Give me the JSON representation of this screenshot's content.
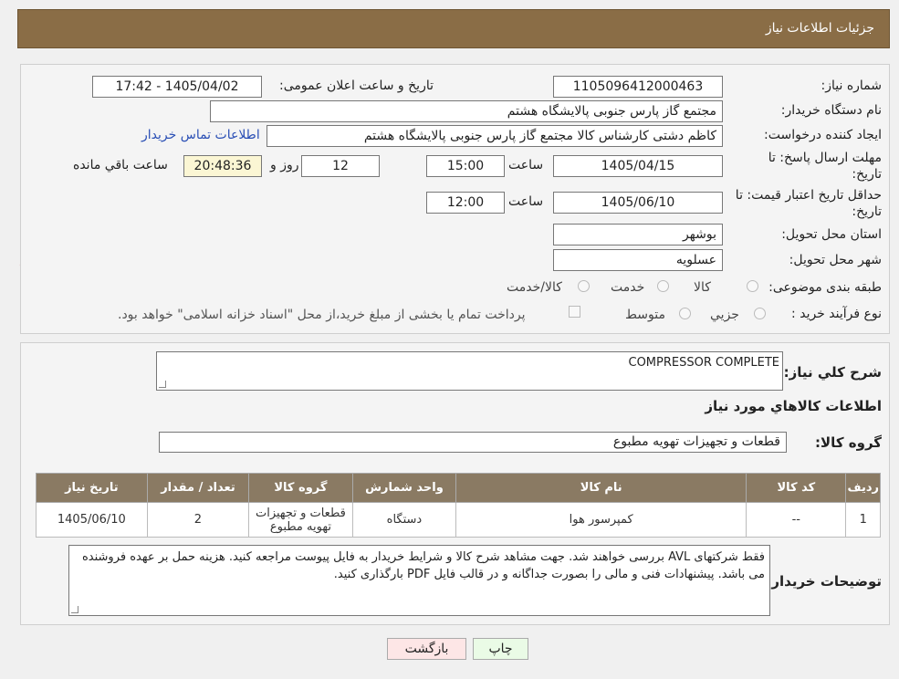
{
  "header": {
    "title": "جزئیات اطلاعات نیاز"
  },
  "form": {
    "need_number_label": "شماره نیاز:",
    "need_number": "1105096412000463",
    "announce_label": "تاریخ و ساعت اعلان عمومی:",
    "announce_value": "1405/04/02 - 17:42",
    "buyer_org_label": "نام دستگاه خریدار:",
    "buyer_org": "مجتمع گاز پارس جنوبی  پالایشگاه هشتم",
    "requester_label": "ایجاد کننده درخواست:",
    "requester": "کاظم دشتی کارشناس کالا مجتمع گاز پارس جنوبی  پالایشگاه هشتم",
    "contact_link": "اطلاعات تماس خریدار",
    "deadline_label_1": "مهلت ارسال پاسخ: تا",
    "deadline_label_2": "تاریخ:",
    "deadline_date": "1405/04/15",
    "time_label": "ساعت",
    "deadline_time": "15:00",
    "days_value": "12",
    "days_label": "روز و",
    "remaining_time": "20:48:36",
    "remaining_label": "ساعت باقي مانده",
    "validity_label_1": "حداقل تاریخ اعتبار قیمت: تا",
    "validity_label_2": "تاریخ:",
    "validity_date": "1405/06/10",
    "validity_time": "12:00",
    "province_label": "استان محل تحویل:",
    "province": "بوشهر",
    "city_label": "شهر محل تحویل:",
    "city": "عسلویه",
    "category_label": "طبقه بندی موضوعی:",
    "category_opts": [
      "کالا",
      "خدمت",
      "کالا/خدمت"
    ],
    "process_label": "نوع فرآیند خرید :",
    "process_opts": [
      "جزيي",
      "متوسط"
    ],
    "treasury_text": "پرداخت تمام یا بخشی از مبلغ خرید،از محل \"اسناد خزانه اسلامی\" خواهد بود."
  },
  "details": {
    "general_desc_label": "شرح كلي نياز:",
    "general_desc": "COMPRESSOR COMPLETE",
    "goods_info_title": "اطلاعات كالاهاي مورد نياز",
    "goods_group_label": "گروه كالا:",
    "goods_group": "قطعات و تجهیزات تهویه مطبوع"
  },
  "table": {
    "headers": [
      "رديف",
      "كد كالا",
      "نام كالا",
      "واحد شمارش",
      "گروه كالا",
      "تعداد / مقدار",
      "تاريخ نياز"
    ],
    "rows": [
      {
        "row": "1",
        "code": "--",
        "name": "کمپرسور هوا",
        "unit": "دستگاه",
        "group": "قطعات و تجهیزات تهویه مطبوع",
        "qty": "2",
        "date": "1405/06/10"
      }
    ]
  },
  "buyer_notes": {
    "label": "توضيحات خريدار:",
    "text": "فقط شرکتهای AVL  بررسی خواهند شد. جهت مشاهد شرح کالا و شرایط خریدار به فایل پیوست مراجعه کنید. هزینه حمل بر عهده فروشنده می باشد. پیشنهادات فنی و مالی را بصورت جداگانه و در قالب فایل PDF  بارگذاری کنید."
  },
  "buttons": {
    "print": "چاپ",
    "back": "بازگشت"
  },
  "colors": {
    "header_bg": "#8a6d46",
    "table_header_bg": "#8a7a63",
    "link": "#2a4fb5"
  }
}
